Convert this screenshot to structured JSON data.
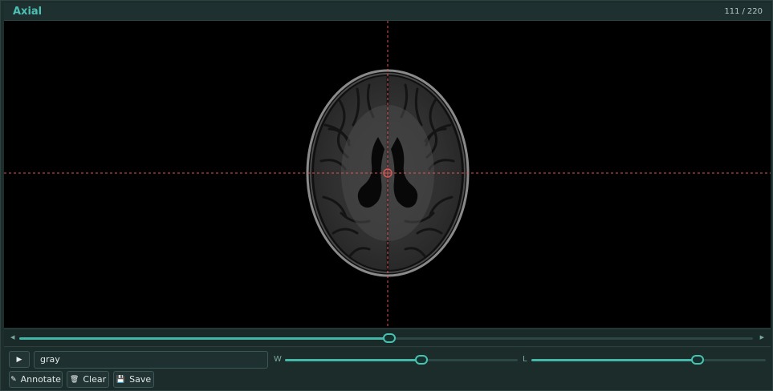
{
  "header": {
    "title": "Axial",
    "slice_current": "111",
    "slice_sep": "/",
    "slice_total": "220"
  },
  "slice_slider": {
    "position": 0.5043
  },
  "controls": {
    "play_icon": "play-icon",
    "colormap_value": "gray",
    "window_label": "W",
    "level_label": "L",
    "window_position": 0.585,
    "level_position": 0.71,
    "annotate_label": "Annotate",
    "clear_label": "Clear",
    "save_label": "Save"
  },
  "colors": {
    "accent": "#45b7a8",
    "crosshair": "#e05555",
    "background": "#1c2d2c"
  }
}
